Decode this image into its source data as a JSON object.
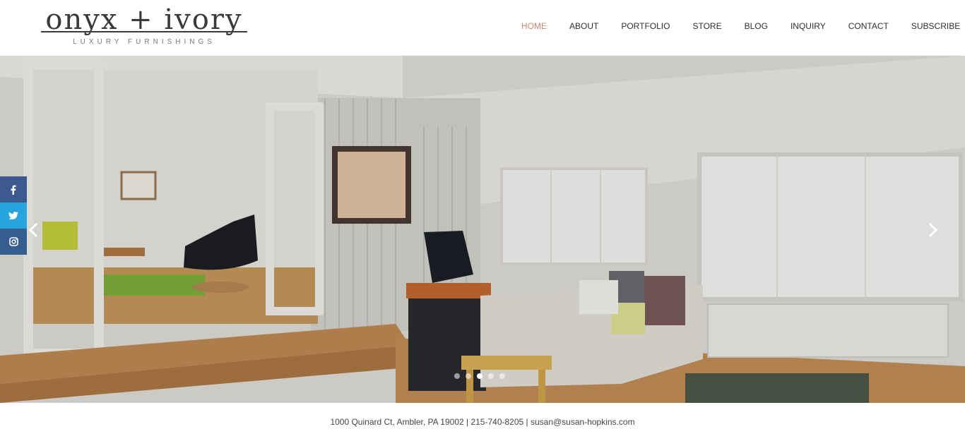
{
  "brand": {
    "name": "onyx + ivory",
    "tagline": "LUXURY FURNISHINGS"
  },
  "nav": {
    "items": [
      {
        "label": "HOME",
        "active": true
      },
      {
        "label": "ABOUT",
        "active": false
      },
      {
        "label": "PORTFOLIO",
        "active": false
      },
      {
        "label": "STORE",
        "active": false
      },
      {
        "label": "BLOG",
        "active": false
      },
      {
        "label": "INQUIRY",
        "active": false
      },
      {
        "label": "CONTACT",
        "active": false
      },
      {
        "label": "SUBSCRIBE",
        "active": false
      }
    ]
  },
  "colors": {
    "nav_active": "#c9886e",
    "facebook": "#3c5a8e",
    "twitter": "#27a4dd",
    "instagram": "#355e8f"
  },
  "social": {
    "facebook_icon": "facebook-icon",
    "twitter_icon": "twitter-icon",
    "instagram_icon": "instagram-icon"
  },
  "slider": {
    "slide_count": 5,
    "active_slide": 3,
    "prev_icon": "chevron-left-icon",
    "next_icon": "chevron-right-icon"
  },
  "footer": {
    "contact": "1000 Quinard Ct, Ambler, PA 19002 | 215-740-8205 | susan@susan-hopkins.com"
  }
}
